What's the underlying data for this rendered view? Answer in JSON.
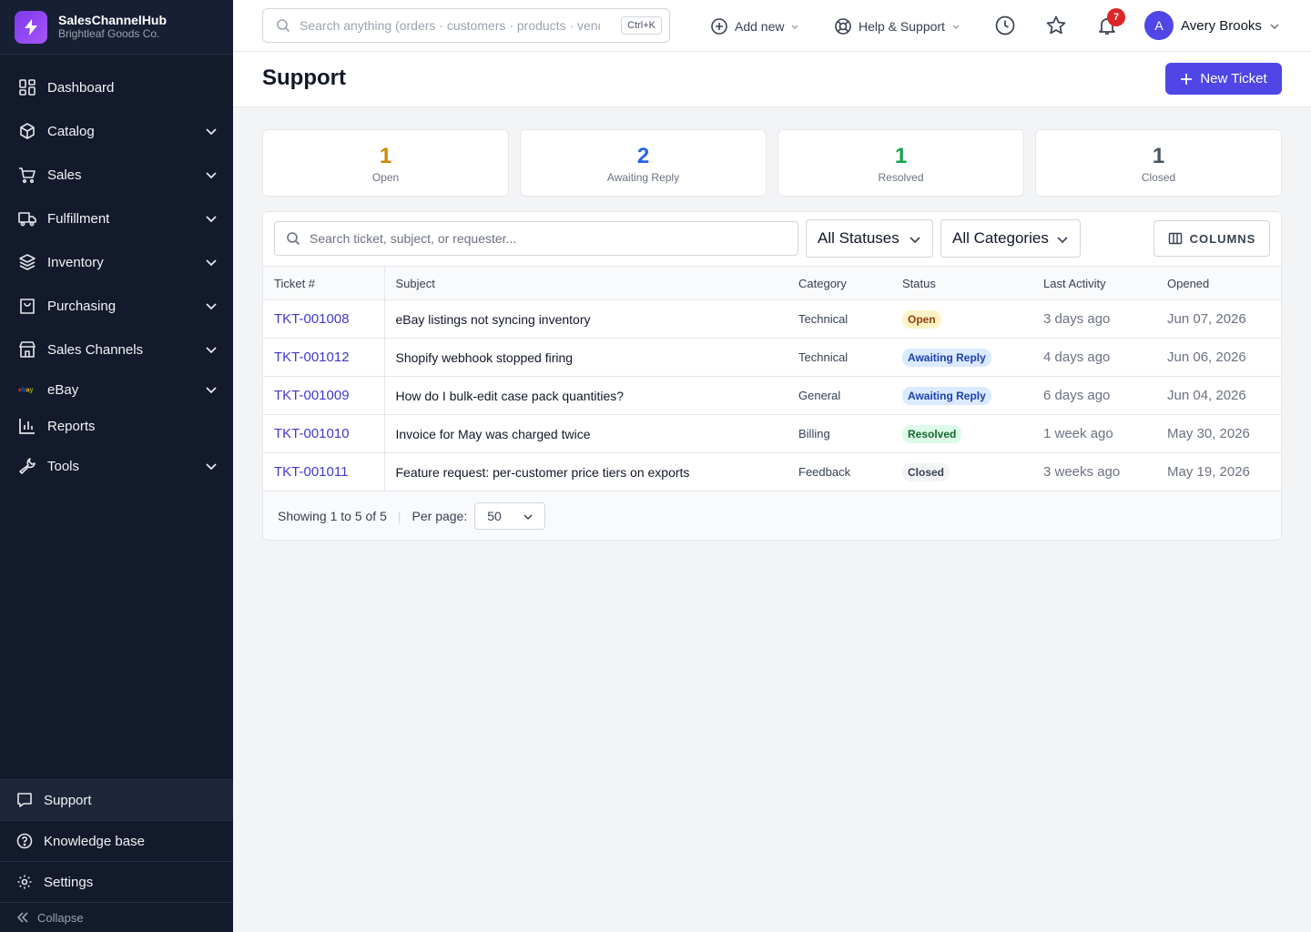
{
  "brand": {
    "name": "SalesChannelHub",
    "company": "Brightleaf Goods Co."
  },
  "sidebar": {
    "items": [
      {
        "label": "Dashboard",
        "icon": "dashboard-icon",
        "expandable": false
      },
      {
        "label": "Catalog",
        "icon": "box-icon",
        "expandable": true
      },
      {
        "label": "Sales",
        "icon": "cart-icon",
        "expandable": true
      },
      {
        "label": "Fulfillment",
        "icon": "truck-icon",
        "expandable": true
      },
      {
        "label": "Inventory",
        "icon": "layers-icon",
        "expandable": true
      },
      {
        "label": "Purchasing",
        "icon": "bag-icon",
        "expandable": true
      },
      {
        "label": "Sales Channels",
        "icon": "store-icon",
        "expandable": true
      },
      {
        "label": "eBay",
        "icon": "ebay-logo-icon",
        "expandable": true,
        "logo_text": "ebay"
      },
      {
        "label": "Reports",
        "icon": "bar-chart-icon",
        "expandable": false
      },
      {
        "label": "Tools",
        "icon": "wrench-icon",
        "expandable": true
      }
    ],
    "bottom": [
      {
        "label": "Support",
        "icon": "chat-icon",
        "active": true
      },
      {
        "label": "Knowledge base",
        "icon": "help-circle-icon",
        "active": false
      },
      {
        "label": "Settings",
        "icon": "gear-icon",
        "active": false
      }
    ],
    "collapse_label": "Collapse"
  },
  "topbar": {
    "search_placeholder": "Search anything (orders · customers · products · vendors)",
    "search_shortcut": "Ctrl+K",
    "add_new": "Add new",
    "help": "Help & Support",
    "notification_count": "7",
    "user_initial": "A",
    "user_name": "Avery Brooks"
  },
  "page": {
    "title": "Support",
    "new_ticket": "New Ticket"
  },
  "stats": [
    {
      "value": "1",
      "label": "Open",
      "color": "#ca8a04"
    },
    {
      "value": "2",
      "label": "Awaiting Reply",
      "color": "#2563eb"
    },
    {
      "value": "1",
      "label": "Resolved",
      "color": "#16a34a"
    },
    {
      "value": "1",
      "label": "Closed",
      "color": "#4b5563"
    }
  ],
  "filters": {
    "search_placeholder": "Search ticket, subject, or requester...",
    "status": "All Statuses",
    "category": "All Categories",
    "columns": "COLUMNS"
  },
  "table": {
    "headers": [
      "Ticket #",
      "Subject",
      "Category",
      "Status",
      "Last Activity",
      "Opened"
    ],
    "rows": [
      {
        "id": "TKT-001008",
        "subject": "eBay listings not syncing inventory",
        "category": "Technical",
        "status": "Open",
        "status_bg": "#fef3c7",
        "status_fg": "#92400e",
        "last": "3 days ago",
        "opened": "Jun 07, 2026"
      },
      {
        "id": "TKT-001012",
        "subject": "Shopify webhook stopped firing",
        "category": "Technical",
        "status": "Awaiting Reply",
        "status_bg": "#dbeafe",
        "status_fg": "#1e40af",
        "last": "4 days ago",
        "opened": "Jun 06, 2026"
      },
      {
        "id": "TKT-001009",
        "subject": "How do I bulk-edit case pack quantities?",
        "category": "General",
        "status": "Awaiting Reply",
        "status_bg": "#dbeafe",
        "status_fg": "#1e40af",
        "last": "6 days ago",
        "opened": "Jun 04, 2026"
      },
      {
        "id": "TKT-001010",
        "subject": "Invoice for May was charged twice",
        "category": "Billing",
        "status": "Resolved",
        "status_bg": "#dcfce7",
        "status_fg": "#166534",
        "last": "1 week ago",
        "opened": "May 30, 2026"
      },
      {
        "id": "TKT-001011",
        "subject": "Feature request: per-customer price tiers on exports",
        "category": "Feedback",
        "status": "Closed",
        "status_bg": "#f3f4f6",
        "status_fg": "#374151",
        "last": "3 weeks ago",
        "opened": "May 19, 2026"
      }
    ]
  },
  "pagination": {
    "showing": "Showing 1 to 5 of 5",
    "per_page_label": "Per page:",
    "per_page": "50"
  }
}
